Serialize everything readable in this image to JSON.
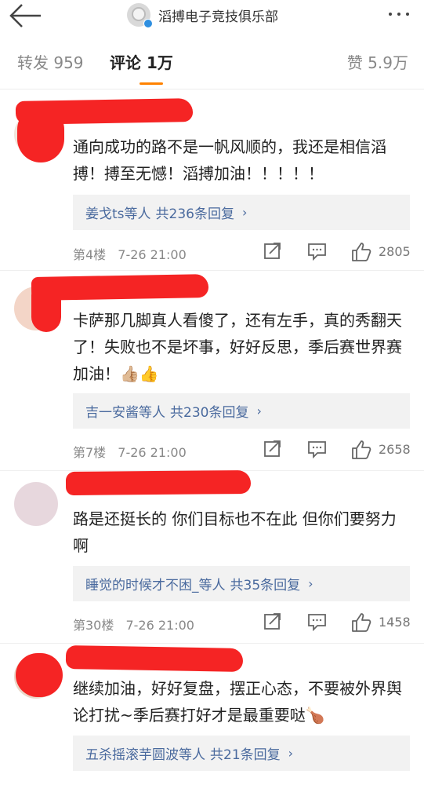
{
  "header": {
    "account_name": "滔搏电子竞技俱乐部"
  },
  "tabs": {
    "repost": "转发 959",
    "comment": "评论 1万",
    "like": "赞 5.9万"
  },
  "comments": [
    {
      "text": "通向成功的路不是一帆风顺的，我还是相信滔搏！搏至无憾！滔搏加油！！！！！",
      "replies_users": "姜戈ts等人",
      "replies_count": "共236条回复",
      "chevron": "›",
      "floor": "第4楼",
      "time": "7-26 21:00",
      "likes": "2805"
    },
    {
      "text": "卡萨那几脚真人看傻了，还有左手，真的秀翻天了！失败也不是坏事，好好反思，季后赛世界赛加油！",
      "emoji": "👍🏼👍",
      "replies_users": "吉一安酱等人",
      "replies_count": "共230条回复",
      "chevron": "›",
      "floor": "第7楼",
      "time": "7-26 21:00",
      "likes": "2658"
    },
    {
      "text": "路是还挺长的 你们目标也不在此 但你们要努力啊",
      "replies_users": "睡觉的时候才不困_等人",
      "replies_count": "共35条回复",
      "chevron": "›",
      "floor": "第30楼",
      "time": "7-26 21:00",
      "likes": "1458"
    },
    {
      "text": "继续加油，好好复盘，摆正心态，不要被外界舆论打扰~季后赛打好才是最重要哒",
      "emoji": "🍗",
      "replies_users": "五杀摇滚芋圆波等人",
      "replies_count": "共21条回复",
      "chevron": "›"
    }
  ],
  "icons": {
    "back": "back-arrow-icon",
    "more": "more-dots-icon",
    "share": "share-icon",
    "comment": "comment-icon",
    "like": "thumbs-up-icon"
  },
  "colors": {
    "tab_accent": "#ff8200",
    "link": "#4a6a9e",
    "redaction": "#f52424"
  }
}
